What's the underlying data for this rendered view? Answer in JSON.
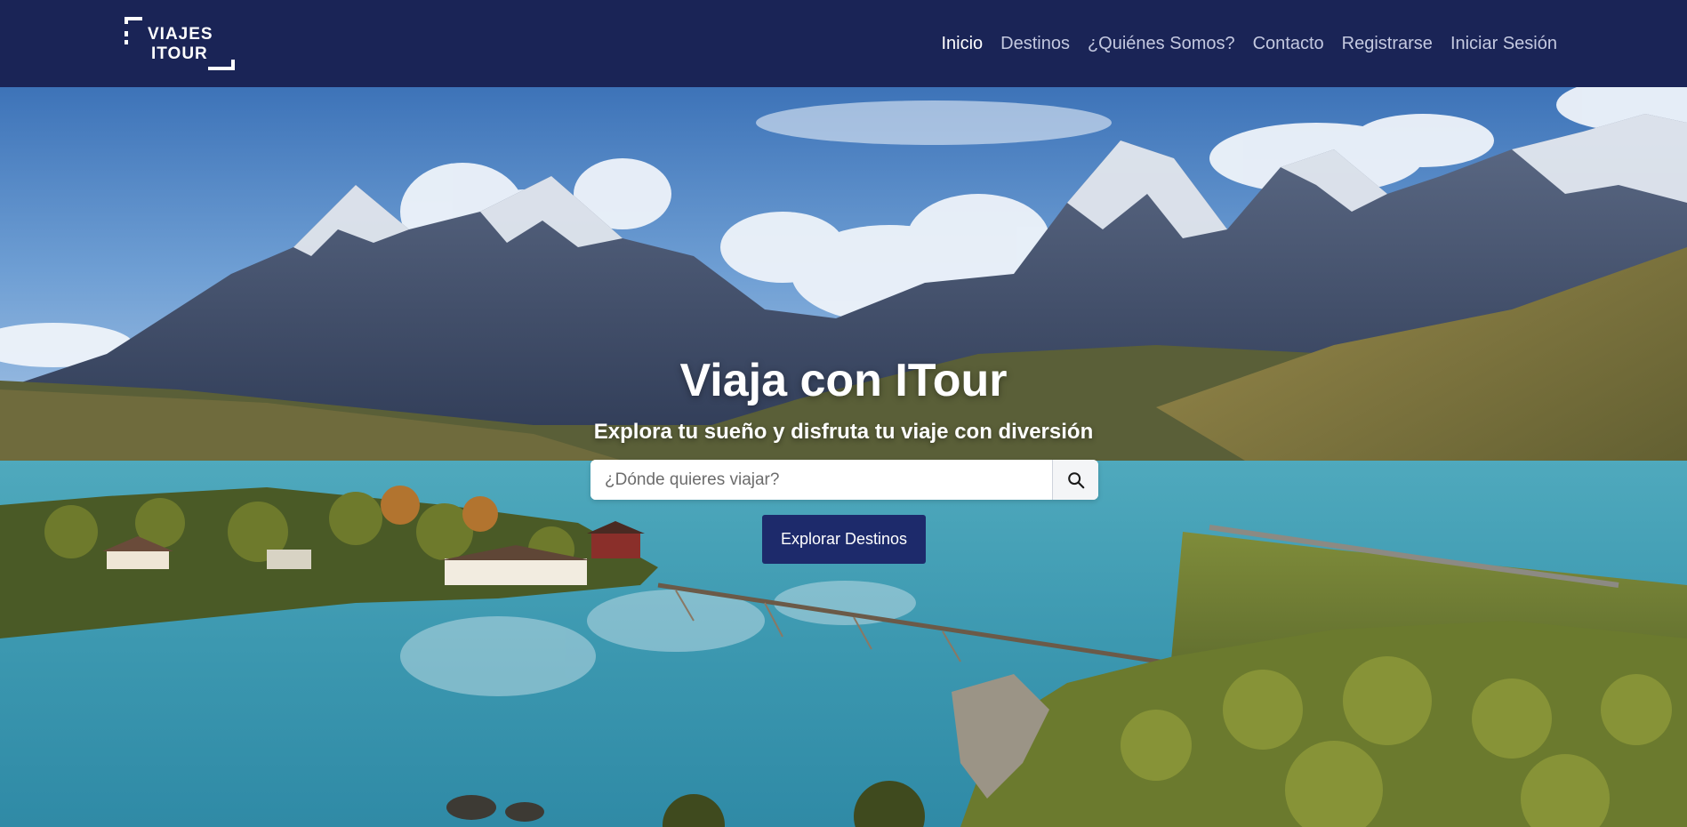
{
  "brand": {
    "logo_line1": "VIAJES",
    "logo_line2": "ITOUR"
  },
  "nav": {
    "items": [
      {
        "label": "Inicio",
        "active": true
      },
      {
        "label": "Destinos",
        "active": false
      },
      {
        "label": "¿Quiénes Somos?",
        "active": false
      },
      {
        "label": "Contacto",
        "active": false
      },
      {
        "label": "Registrarse",
        "active": false
      },
      {
        "label": "Iniciar Sesión",
        "active": false
      }
    ]
  },
  "hero": {
    "title": "Viaja con ITour",
    "subtitle": "Explora tu sueño y disfruta tu viaje con diversión",
    "search": {
      "placeholder": "¿Dónde quieres viajar?",
      "value": "",
      "button_icon": "search-icon"
    },
    "cta_label": "Explorar Destinos"
  },
  "colors": {
    "navbar_bg": "#1a2456",
    "nav_link": "#c4c9e0",
    "nav_link_active": "#ffffff",
    "cta_bg": "#1d2a6b",
    "text_light": "#ffffff"
  }
}
